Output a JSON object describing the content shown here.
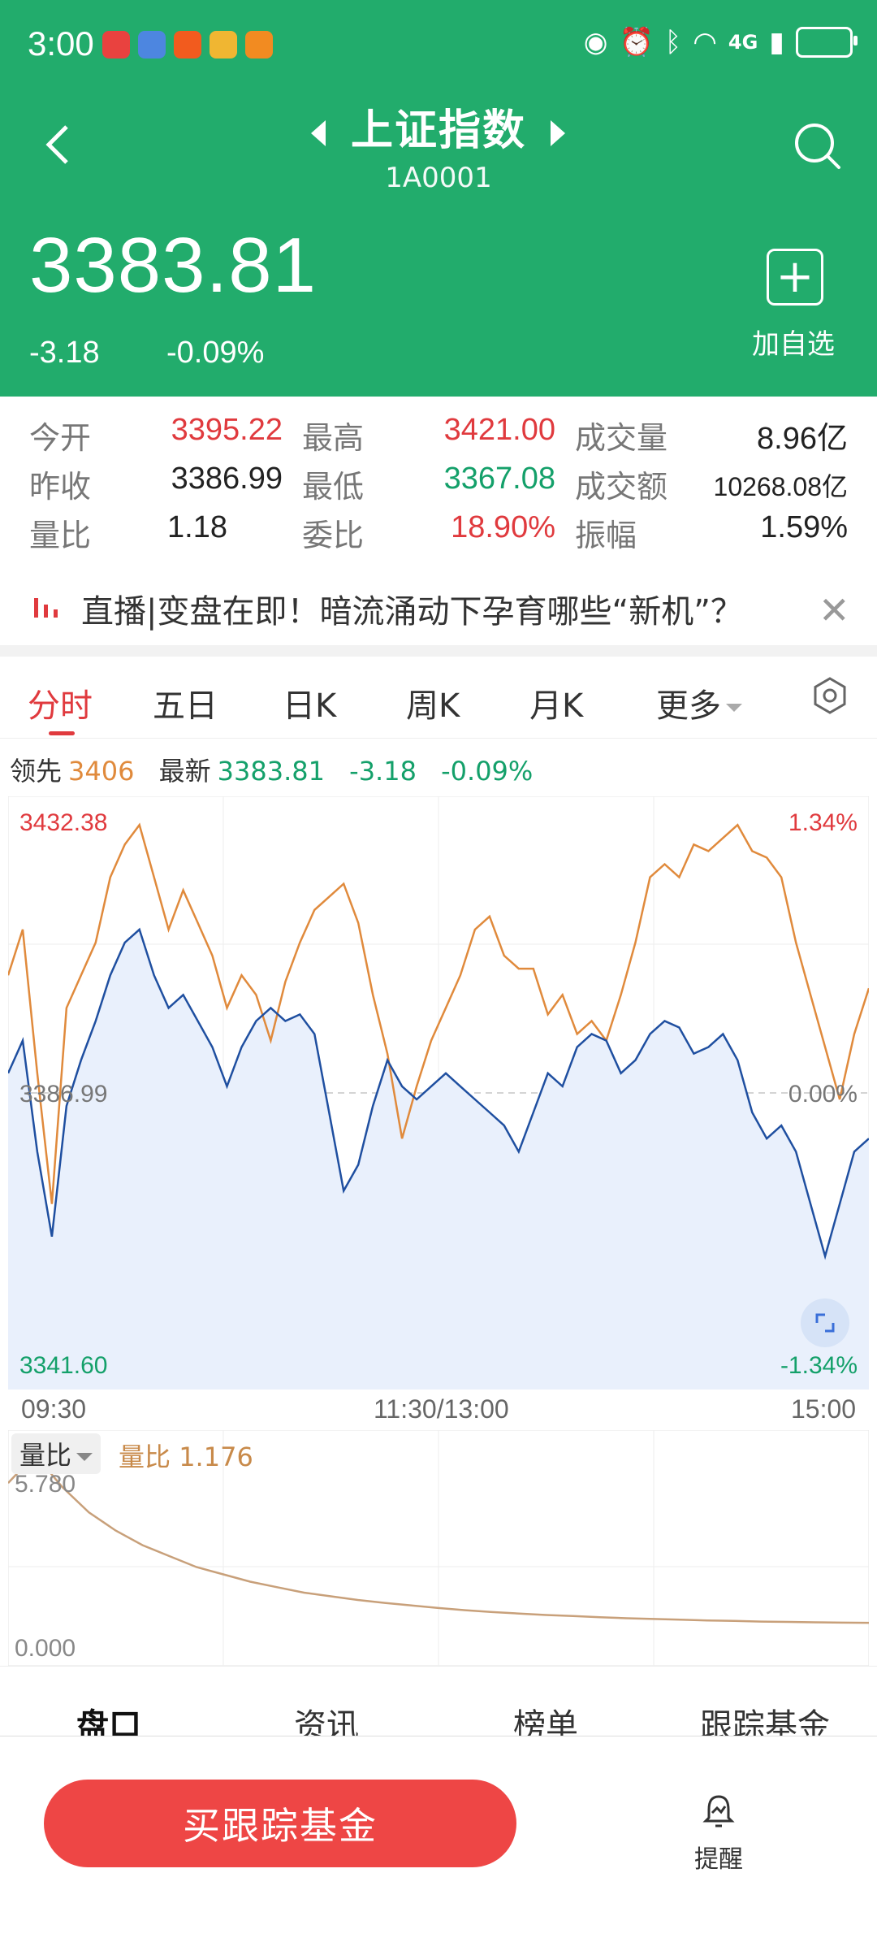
{
  "status_bar": {
    "time": "3:00",
    "network": "4G",
    "app_icons": [
      "app-red",
      "music-app",
      "taobao-app",
      "weibo-app",
      "video-app"
    ]
  },
  "header": {
    "title": "上证指数",
    "code": "1A0001",
    "price": "3383.81",
    "change": "-3.18",
    "change_pct": "-0.09%",
    "add_label": "加自选",
    "bg_color": "#22ac6c"
  },
  "stats": [
    [
      {
        "label": "今开",
        "value": "3395.22",
        "color": "red"
      },
      {
        "label": "最高",
        "value": "3421.00",
        "color": "red"
      },
      {
        "label": "成交量",
        "value": "8.96亿",
        "color": "black"
      }
    ],
    [
      {
        "label": "昨收",
        "value": "3386.99",
        "color": "black"
      },
      {
        "label": "最低",
        "value": "3367.08",
        "color": "green"
      },
      {
        "label": "成交额",
        "value": "10268.08亿",
        "color": "black"
      }
    ],
    [
      {
        "label": "量比",
        "value": "1.18",
        "color": "black"
      },
      {
        "label": "委比",
        "value": "18.90%",
        "color": "red"
      },
      {
        "label": "振幅",
        "value": "1.59%",
        "color": "black"
      }
    ]
  ],
  "banner": {
    "text": "直播|变盘在即！暗流涌动下孕育哪些“新机”？"
  },
  "tabs": [
    "分时",
    "五日",
    "日K",
    "周K",
    "月K",
    "更多"
  ],
  "info_line": {
    "leader_label": "领先",
    "leader_value": "3406",
    "latest_label": "最新",
    "latest_value": "3383.81",
    "change": "-3.18",
    "change_pct": "-0.09%"
  },
  "chart_data": {
    "type": "line",
    "x": [
      "09:30",
      "11:30/13:00",
      "15:00"
    ],
    "ylim": [
      3341.6,
      3432.38
    ],
    "y_top_label": "3432.38",
    "y_mid_label": "3386.99",
    "y_bottom_label": "3341.60",
    "pct_top": "1.34%",
    "pct_mid": "0.00%",
    "pct_bottom": "-1.34%",
    "series": [
      {
        "color": "#e08a3c",
        "values": [
          3405,
          3412,
          3390,
          3370,
          3400,
          3405,
          3410,
          3420,
          3425,
          3428,
          3420,
          3412,
          3418,
          3413,
          3408,
          3400,
          3405,
          3402,
          3395,
          3404,
          3410,
          3415,
          3417,
          3419,
          3413,
          3402,
          3393,
          3380,
          3388,
          3395,
          3400,
          3405,
          3412,
          3414,
          3408,
          3406,
          3406,
          3399,
          3402,
          3396,
          3398,
          3395,
          3402,
          3410,
          3420,
          3422,
          3420,
          3425,
          3424,
          3426,
          3428,
          3424,
          3423,
          3420,
          3410,
          3402,
          3394,
          3386,
          3396,
          3403
        ]
      },
      {
        "color": "#1f4fa0",
        "values": [
          3390,
          3395,
          3378,
          3365,
          3385,
          3392,
          3398,
          3405,
          3410,
          3412,
          3405,
          3400,
          3402,
          3398,
          3394,
          3388,
          3394,
          3398,
          3400,
          3398,
          3399,
          3396,
          3384,
          3372,
          3376,
          3385,
          3392,
          3388,
          3386,
          3388,
          3390,
          3388,
          3386,
          3384,
          3382,
          3378,
          3384,
          3390,
          3388,
          3394,
          3396,
          3395,
          3390,
          3392,
          3396,
          3398,
          3397,
          3393,
          3394,
          3396,
          3392,
          3384,
          3380,
          3382,
          3378,
          3370,
          3362,
          3370,
          3378,
          3380
        ]
      }
    ]
  },
  "volume_chart": {
    "tab_label": "量比",
    "ratio_label": "量比",
    "ratio_value": "1.176",
    "top_label": "5.780",
    "bottom_label": "0.000",
    "ylim": [
      0,
      5.78
    ],
    "values": [
      5.0,
      5.78,
      4.9,
      4.2,
      3.7,
      3.3,
      3.0,
      2.7,
      2.5,
      2.3,
      2.15,
      2.0,
      1.9,
      1.8,
      1.72,
      1.65,
      1.58,
      1.52,
      1.47,
      1.43,
      1.39,
      1.36,
      1.33,
      1.3,
      1.28,
      1.26,
      1.24,
      1.23,
      1.21,
      1.2,
      1.19,
      1.18,
      1.176
    ]
  },
  "bottom_tabs": [
    "盘口",
    "资讯",
    "榜单",
    "跟踪基金"
  ],
  "action": {
    "buy_label": "买跟踪基金",
    "remind_label": "提醒"
  }
}
